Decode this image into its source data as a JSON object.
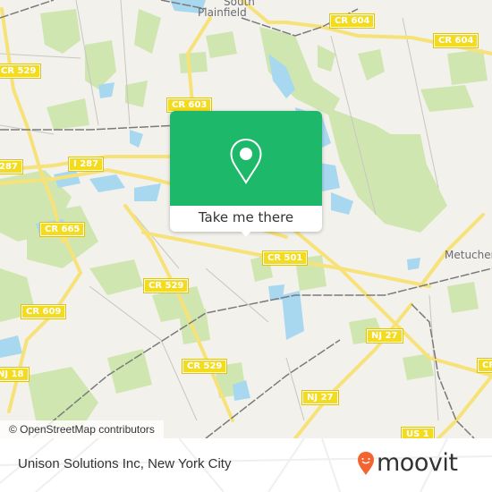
{
  "map": {
    "attribution": "© OpenStreetMap contributors",
    "place_labels": [
      {
        "id": "south",
        "text": "South"
      },
      {
        "id": "plainfield",
        "text": "Plainfield"
      },
      {
        "id": "metuchen",
        "text": "Metuchen"
      }
    ],
    "road_shields": [
      {
        "id": "cr529-a",
        "text": "CR 529"
      },
      {
        "id": "cr603",
        "text": "CR 603"
      },
      {
        "id": "cr604-a",
        "text": "CR 604"
      },
      {
        "id": "cr604-b",
        "text": "CR 604"
      },
      {
        "id": "i287-a",
        "text": "I 287"
      },
      {
        "id": "i287-b",
        "text": "287"
      },
      {
        "id": "cr665",
        "text": "CR 665"
      },
      {
        "id": "cr501",
        "text": "CR 501"
      },
      {
        "id": "cr529-b",
        "text": "CR 529"
      },
      {
        "id": "cr609",
        "text": "CR 609"
      },
      {
        "id": "nj18",
        "text": "NJ 18"
      },
      {
        "id": "cr529-c",
        "text": "CR 529"
      },
      {
        "id": "nj27-a",
        "text": "NJ 27"
      },
      {
        "id": "nj27-b",
        "text": "NJ 27"
      },
      {
        "id": "cr-right",
        "text": "CR"
      },
      {
        "id": "us1",
        "text": "US 1"
      }
    ],
    "colors": {
      "land": "#f2f1ec",
      "park": "#cfe6b0",
      "water": "#a8d8f0",
      "road": "#f7e27a",
      "rail": "#7a7a7a"
    }
  },
  "popup": {
    "icon": "location-pin-icon",
    "button_label": "Take me there",
    "accent": "#1db86a"
  },
  "footer": {
    "location_title": "Unison Solutions Inc, New York City",
    "brand": "moovit",
    "brand_color": "#f26430"
  }
}
